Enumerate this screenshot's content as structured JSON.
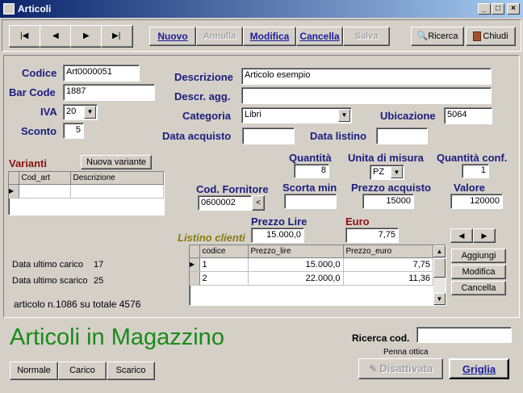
{
  "window": {
    "title": "Articoli"
  },
  "toolbar": {
    "first_icon": "first-record-icon",
    "prev_icon": "prev-record-icon",
    "next_icon": "next-record-icon",
    "last_icon": "last-record-icon",
    "nuovo": "Nuovo",
    "annulla": "Annulla",
    "modifica": "Modifica",
    "cancella": "Cancella",
    "salva": "Salva",
    "ricerca": "Ricerca",
    "chiudi": "Chiudi"
  },
  "form": {
    "codice_label": "Codice",
    "codice_value": "Art0000051",
    "barcode_label": "Bar Code",
    "barcode_value": "1887",
    "iva_label": "IVA",
    "iva_value": "20",
    "sconto_label": "Sconto",
    "sconto_value": "5",
    "descrizione_label": "Descrizione",
    "descrizione_value": "Articolo esempio",
    "descr_agg_label": "Descr. agg.",
    "descr_agg_value": "",
    "categoria_label": "Categoria",
    "categoria_value": "Libri",
    "ubicazione_label": "Ubicazione",
    "ubicazione_value": "5064",
    "data_acquisto_label": "Data acquisto",
    "data_acquisto_value": "",
    "data_listino_label": "Data listino",
    "data_listino_value": "",
    "quantita_label": "Quantità",
    "quantita_value": "8",
    "unita_label": "Unita di misura",
    "unita_value": "PZ",
    "quantita_conf_label": "Quantità conf.",
    "quantita_conf_value": "1",
    "cod_fornitore_label": "Cod. Fornitore",
    "cod_fornitore_value": "0600002",
    "scorta_min_label": "Scorta min",
    "scorta_min_value": "",
    "prezzo_acquisto_label": "Prezzo acquisto",
    "prezzo_acquisto_value": "15000",
    "valore_label": "Valore",
    "valore_value": "120000"
  },
  "varianti": {
    "label": "Varianti",
    "nuova_button": "Nuova variante",
    "columns": [
      "Cod_art",
      "Descrizione"
    ]
  },
  "listino": {
    "label": "Listino clienti",
    "prezzo_lire_label": "Prezzo Lire",
    "prezzo_lire_value": "15.000,0",
    "euro_label": "Euro",
    "euro_value": "7,75",
    "columns": [
      "codice",
      "Prezzo_lire",
      "Prezzo_euro"
    ],
    "rows": [
      {
        "codice": "1",
        "lire": "15.000,0",
        "euro": "7,75"
      },
      {
        "codice": "2",
        "lire": "22.000,0",
        "euro": "11,36"
      }
    ],
    "aggiungi": "Aggiungi",
    "modifica": "Modifica",
    "cancella": "Cancella"
  },
  "stats": {
    "ultimo_carico_label": "Data ultimo carico",
    "ultimo_carico_value": "17",
    "ultimo_scarico_label": "Data ultimo scarico",
    "ultimo_scarico_value": "25",
    "record_info": "articolo n.1086 su totale 4576"
  },
  "footer": {
    "heading": "Articoli in Magazzino",
    "normale": "Normale",
    "carico": "Carico",
    "scarico": "Scarico",
    "ricerca_cod_label": "Ricerca cod.",
    "ricerca_cod_value": "",
    "penna_label": "Penna ottica",
    "disattivata": "Disattivata",
    "griglia": "Griglia"
  },
  "colors": {
    "heading_green": "#1a8a1a",
    "label_navy": "#1c1c7c",
    "listino_olive": "#8a7a10",
    "varianti_red": "#8b1010",
    "euro_red": "#8b1010"
  }
}
